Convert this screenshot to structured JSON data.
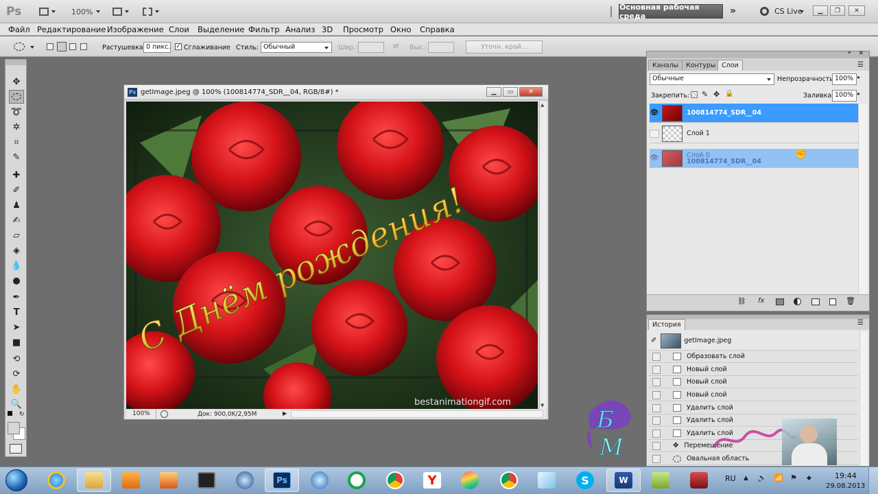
{
  "app": {
    "logo": "Ps",
    "zoom": "100%",
    "workspace": "Основная рабочая среда",
    "cs_live": "CS Live",
    "colors": {
      "accent": "#3b9bff",
      "chrome": "#d4d4d4",
      "workspace_btn": "#5a5a5a"
    }
  },
  "menu": [
    "Файл",
    "Редактирование",
    "Изображение",
    "Слои",
    "Выделение",
    "Фильтр",
    "Анализ",
    "3D",
    "Просмотр",
    "Окно",
    "Справка"
  ],
  "options": {
    "feather_label": "Растушевка:",
    "feather_value": "0 пикс.",
    "antialias_label": "Сглаживание",
    "style_label": "Стиль:",
    "style_value": "Обычный",
    "width_label": "Шир.:",
    "height_label": "Выс.:",
    "refine_label": "Уточн. край..."
  },
  "document": {
    "title": "getImage.jpeg @ 100% (100814774_SDR__04, RGB/8#) *",
    "zoom": "100%",
    "doc_info": "Док: 900,0K/2,95M",
    "image_text": "С Днём рождения!",
    "watermark": "bestanimationgif.com",
    "rose_color": "#c8141a"
  },
  "layers_panel": {
    "tabs": [
      "Каналы",
      "Контуры",
      "Слои"
    ],
    "active_tab": "Слои",
    "blend_mode": "Обычные",
    "opacity_label": "Непрозрачность:",
    "opacity_value": "100%",
    "lock_label": "Закрепить:",
    "fill_label": "Заливка:",
    "fill_value": "100%",
    "layers": [
      {
        "name": "100814774_SDR__04",
        "selected": true,
        "visible": true
      },
      {
        "name": "Слой 1",
        "selected": false,
        "visible": false
      },
      {
        "name": "Слой 0",
        "sub": "100814774_SDR__04",
        "selected": false,
        "dragging": true,
        "visible": true
      }
    ]
  },
  "history_panel": {
    "title": "История",
    "snapshot": "getImage.jpeg",
    "items": [
      "Образовать слой",
      "Новый слой",
      "Новый слой",
      "Новый слой",
      "Удалить слой",
      "Удалить слой",
      "Удалить слой",
      "Перемещение",
      "Овальная область"
    ]
  },
  "taskbar": {
    "lang": "RU",
    "time": "19:44",
    "date": "29.08.2013",
    "apps": [
      "explorer",
      "ie",
      "folder",
      "media-player",
      "paint",
      "terminal",
      "steam",
      "photoshop",
      "ccleaner",
      "qip",
      "chrome",
      "yandex",
      "chromium",
      "chrome-canary",
      "paint-net",
      "skype",
      "word",
      "green-app",
      "recorder"
    ]
  }
}
